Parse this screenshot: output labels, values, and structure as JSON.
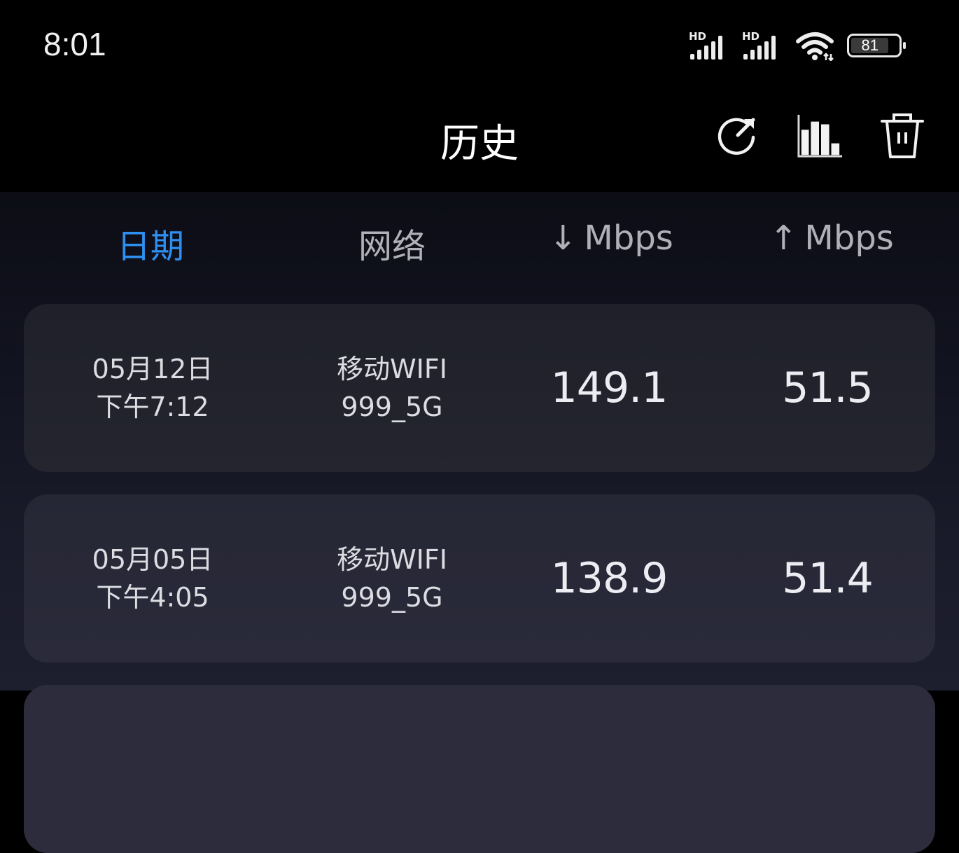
{
  "status_bar": {
    "time": "8:01",
    "signal1_label": "HD",
    "signal2_label": "HD",
    "battery_level": "81",
    "icons": [
      "signal-hd-icon",
      "signal-hd-icon",
      "wifi-icon",
      "battery-icon"
    ]
  },
  "app_bar": {
    "title": "历史",
    "actions": [
      {
        "name": "share",
        "icon": "share-arrow-icon"
      },
      {
        "name": "chart",
        "icon": "bar-chart-icon"
      },
      {
        "name": "delete",
        "icon": "trash-icon"
      }
    ]
  },
  "columns": [
    {
      "key": "date",
      "label": "日期",
      "active": true
    },
    {
      "key": "network",
      "label": "网络",
      "active": false
    },
    {
      "key": "download",
      "arrow": "↓",
      "label": "Mbps",
      "active": false
    },
    {
      "key": "upload",
      "arrow": "↑",
      "label": "Mbps",
      "active": false
    }
  ],
  "accent_color": "#2f8ff0",
  "rows": [
    {
      "date": "05月12日",
      "time": "下午7:12",
      "network_line1": "移动WIFI",
      "network_line2": "999_5G",
      "download": "149.1",
      "upload": "51.5"
    },
    {
      "date": "05月05日",
      "time": "下午4:05",
      "network_line1": "移动WIFI",
      "network_line2": "999_5G",
      "download": "138.9",
      "upload": "51.4"
    }
  ]
}
